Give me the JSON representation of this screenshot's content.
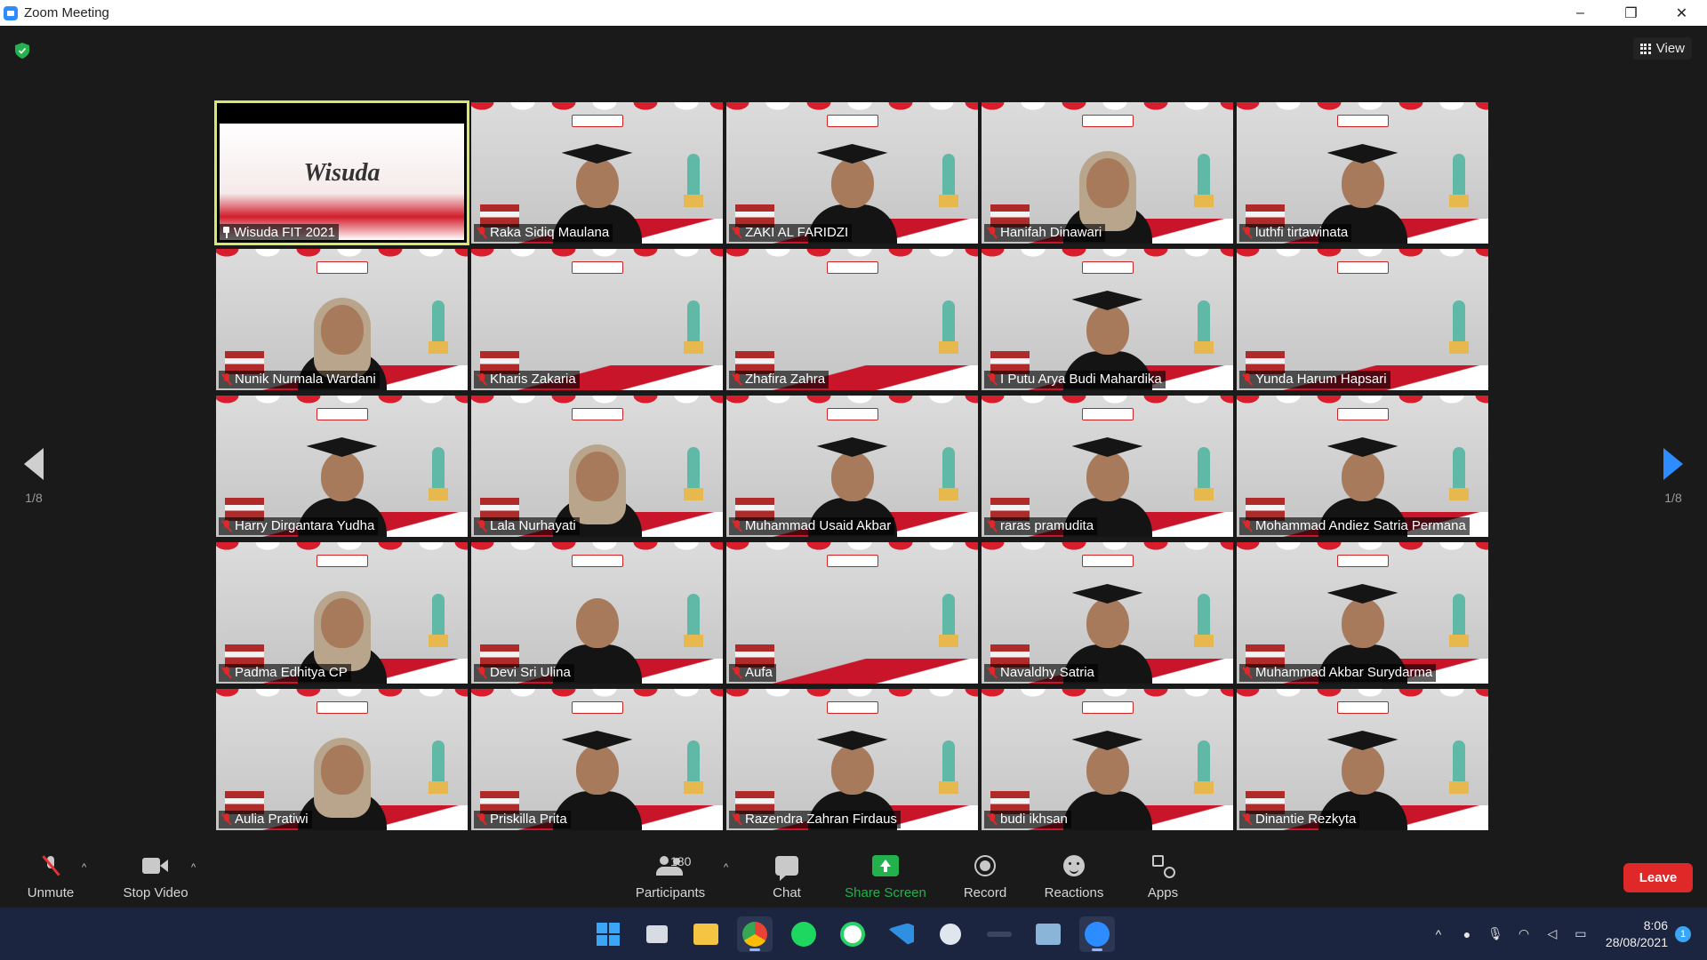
{
  "window": {
    "title": "Zoom Meeting",
    "minimize": "–",
    "restore": "❐",
    "close": "✕"
  },
  "meeting": {
    "view_label": "View",
    "page_indicator_left": "1/8",
    "page_indicator_right": "1/8",
    "security_icon": "shield-check-icon"
  },
  "tiles": [
    {
      "name": "Wisuda FIT 2021",
      "type": "spotlight",
      "banner": "Wisuda"
    },
    {
      "name": "Raka Sidiq Maulana",
      "type": "cap"
    },
    {
      "name": "ZAKI AL FARIDZI",
      "type": "cap"
    },
    {
      "name": "Hanifah Dinawari",
      "type": "hijab"
    },
    {
      "name": "luthfi tirtawinata",
      "type": "cap"
    },
    {
      "name": "Nunik Nurmala Wardani",
      "type": "hijab"
    },
    {
      "name": "Kharis Zakaria",
      "type": "empty"
    },
    {
      "name": "Zhafira Zahra",
      "type": "empty"
    },
    {
      "name": "I Putu Arya Budi Mahardika",
      "type": "cap"
    },
    {
      "name": "Yunda Harum Hapsari",
      "type": "empty"
    },
    {
      "name": "Harry Dirgantara Yudha",
      "type": "cap"
    },
    {
      "name": "Lala Nurhayati",
      "type": "hijab"
    },
    {
      "name": "Muhammad Usaid Akbar",
      "type": "cap"
    },
    {
      "name": "raras pramudita",
      "type": "cap"
    },
    {
      "name": "Mohammad Andiez Satria Permana",
      "type": "cap"
    },
    {
      "name": "Padma Edhitya CP",
      "type": "hijab"
    },
    {
      "name": "Devi Sri Ulina",
      "type": "person"
    },
    {
      "name": "Aufa",
      "type": "empty"
    },
    {
      "name": "Navaldhy Satria",
      "type": "cap"
    },
    {
      "name": "Muhammad Akbar Surydarma",
      "type": "cap"
    },
    {
      "name": "Aulia Pratiwi",
      "type": "hijab"
    },
    {
      "name": "Priskilla Prita",
      "type": "cap"
    },
    {
      "name": "Razendra Zahran Firdaus",
      "type": "cap"
    },
    {
      "name": "budi ikhsan",
      "type": "cap"
    },
    {
      "name": "Dinantie Rezkyta",
      "type": "cap"
    }
  ],
  "toolbar": {
    "unmute": "Unmute",
    "stop_video": "Stop Video",
    "participants": "Participants",
    "participants_count": "180",
    "chat": "Chat",
    "share_screen": "Share Screen",
    "record": "Record",
    "reactions": "Reactions",
    "apps": "Apps",
    "leave": "Leave",
    "caret": "^"
  },
  "taskbar": {
    "apps": [
      "windows-start-icon",
      "task-view-icon",
      "file-explorer-icon",
      "chrome-icon",
      "spotify-icon",
      "whatsapp-icon",
      "vscode-icon",
      "steam-icon",
      "hotspot-icon",
      "photos-icon",
      "zoom-icon"
    ],
    "time": "8:06",
    "date": "28/08/2021",
    "notifications": "1",
    "chevron": "^"
  },
  "colors": {
    "accent_blue": "#2d8cff",
    "share_green": "#23b14d",
    "leave_red": "#e02828",
    "spotlight_outline": "#d9e86b",
    "taskbar": "#1c2540"
  }
}
